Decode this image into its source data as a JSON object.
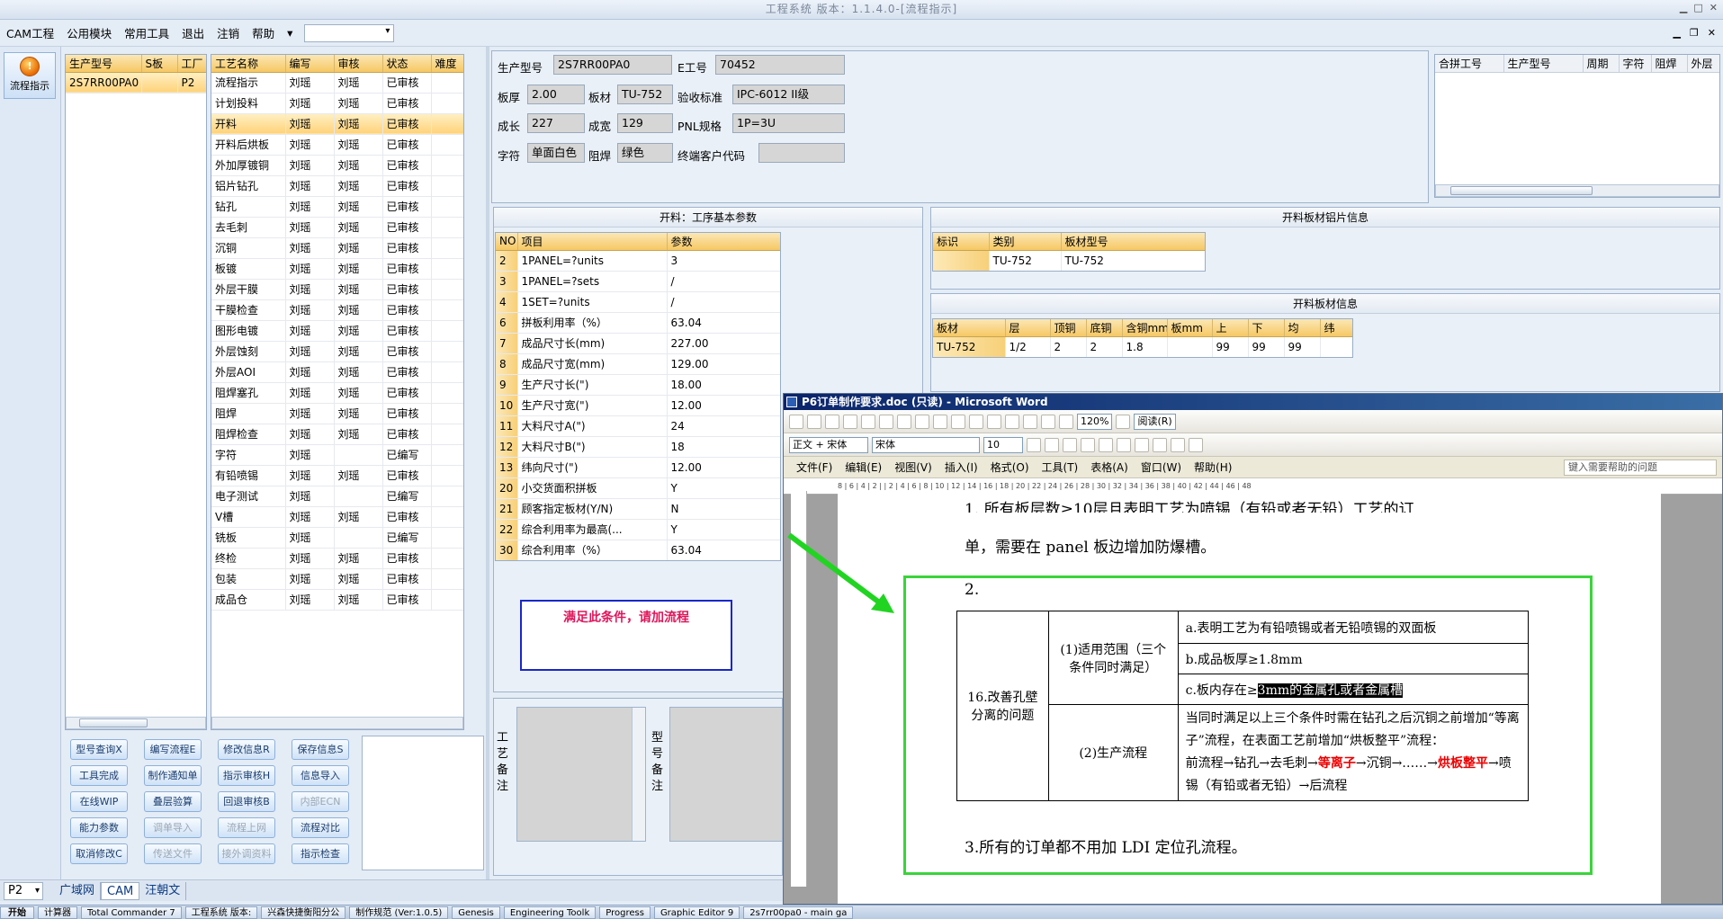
{
  "app": {
    "title": "工程系统 版本：1.1.4.0-[流程指示]",
    "menu": [
      "CAM工程",
      "公用模块",
      "常用工具",
      "退出",
      "注销",
      "帮助"
    ],
    "menu_combo_arrow": "▾",
    "flow_button": "流程指示"
  },
  "part_grid": {
    "headers": [
      "生产型号",
      "S板",
      "工厂"
    ],
    "rows": [
      [
        "2S7RR00PA0",
        "",
        "P2"
      ]
    ]
  },
  "process_grid": {
    "headers": [
      "工艺名称",
      "编写",
      "审核",
      "状态",
      "难度"
    ],
    "selected_index": 2,
    "rows": [
      [
        "流程指示",
        "刘瑶",
        "刘瑶",
        "已审核",
        ""
      ],
      [
        "计划投料",
        "刘瑶",
        "刘瑶",
        "已审核",
        ""
      ],
      [
        "开料",
        "刘瑶",
        "刘瑶",
        "已审核",
        ""
      ],
      [
        "开料后烘板",
        "刘瑶",
        "刘瑶",
        "已审核",
        ""
      ],
      [
        "外加厚镀铜",
        "刘瑶",
        "刘瑶",
        "已审核",
        ""
      ],
      [
        "铝片钻孔",
        "刘瑶",
        "刘瑶",
        "已审核",
        ""
      ],
      [
        "钻孔",
        "刘瑶",
        "刘瑶",
        "已审核",
        ""
      ],
      [
        "去毛刺",
        "刘瑶",
        "刘瑶",
        "已审核",
        ""
      ],
      [
        "沉铜",
        "刘瑶",
        "刘瑶",
        "已审核",
        ""
      ],
      [
        "板镀",
        "刘瑶",
        "刘瑶",
        "已审核",
        ""
      ],
      [
        "外层干膜",
        "刘瑶",
        "刘瑶",
        "已审核",
        ""
      ],
      [
        "干膜检查",
        "刘瑶",
        "刘瑶",
        "已审核",
        ""
      ],
      [
        "图形电镀",
        "刘瑶",
        "刘瑶",
        "已审核",
        ""
      ],
      [
        "外层蚀刻",
        "刘瑶",
        "刘瑶",
        "已审核",
        ""
      ],
      [
        "外层AOI",
        "刘瑶",
        "刘瑶",
        "已审核",
        ""
      ],
      [
        "阻焊塞孔",
        "刘瑶",
        "刘瑶",
        "已审核",
        ""
      ],
      [
        "阻焊",
        "刘瑶",
        "刘瑶",
        "已审核",
        ""
      ],
      [
        "阻焊检查",
        "刘瑶",
        "刘瑶",
        "已审核",
        ""
      ],
      [
        "字符",
        "刘瑶",
        "",
        "已编写",
        ""
      ],
      [
        "有铅喷锡",
        "刘瑶",
        "刘瑶",
        "已审核",
        ""
      ],
      [
        "电子测试",
        "刘瑶",
        "",
        "已编写",
        ""
      ],
      [
        "V槽",
        "刘瑶",
        "刘瑶",
        "已审核",
        ""
      ],
      [
        "铣板",
        "刘瑶",
        "",
        "已编写",
        ""
      ],
      [
        "终检",
        "刘瑶",
        "刘瑶",
        "已审核",
        ""
      ],
      [
        "包装",
        "刘瑶",
        "刘瑶",
        "已审核",
        ""
      ],
      [
        "成品仓",
        "刘瑶",
        "刘瑶",
        "已审核",
        ""
      ]
    ]
  },
  "buttons": [
    {
      "label": "型号查询X",
      "enabled": true
    },
    {
      "label": "编写流程E",
      "enabled": true
    },
    {
      "label": "修改信息R",
      "enabled": true
    },
    {
      "label": "保存信息S",
      "enabled": true
    },
    {
      "label": "工具完成",
      "enabled": true
    },
    {
      "label": "制作通知单",
      "enabled": true
    },
    {
      "label": "指示审核H",
      "enabled": true
    },
    {
      "label": "信息导入",
      "enabled": true
    },
    {
      "label": "在线WIP",
      "enabled": true
    },
    {
      "label": "叠层验算",
      "enabled": true
    },
    {
      "label": "回退审核B",
      "enabled": true
    },
    {
      "label": "内部ECN",
      "enabled": false
    },
    {
      "label": "能力参数",
      "enabled": true
    },
    {
      "label": "调单导入",
      "enabled": false
    },
    {
      "label": "流程上网",
      "enabled": false
    },
    {
      "label": "流程对比",
      "enabled": true
    },
    {
      "label": "取消修改C",
      "enabled": true
    },
    {
      "label": "传送文件",
      "enabled": false
    },
    {
      "label": "接外调资料",
      "enabled": false
    },
    {
      "label": "指示检查",
      "enabled": true
    }
  ],
  "info": {
    "part_no_label": "生产型号",
    "part_no": "2S7RR00PA0",
    "e_no_label": "E工号",
    "e_no": "70452",
    "thickness_label": "板厚",
    "thickness": "2.00",
    "material_label": "板材",
    "material": "TU-752",
    "standard_label": "验收标准",
    "standard": "IPC-6012 II级",
    "len_label": "成长",
    "len": "227",
    "width_label": "成宽",
    "width": "129",
    "pnl_label": "PNL规格",
    "pnl": "1P=3U",
    "char_label": "字符",
    "char": "单面白色",
    "mask_label": "阻焊",
    "mask": "绿色",
    "cust_label": "终端客户代码",
    "cust": ""
  },
  "merge_grid": {
    "headers": [
      "合拼工号",
      "生产型号",
      "周期",
      "字符",
      "阻焊",
      "外层"
    ]
  },
  "params": {
    "title": "开料：工序基本参数",
    "headers": [
      "NO",
      "项目",
      "参数"
    ],
    "rows": [
      [
        "2",
        "1PANEL=?units",
        "3"
      ],
      [
        "3",
        "1PANEL=?sets",
        "/"
      ],
      [
        "4",
        "1SET=?units",
        "/"
      ],
      [
        "6",
        "拼板利用率（%）",
        "63.04"
      ],
      [
        "7",
        "成品尺寸长(mm)",
        "227.00"
      ],
      [
        "8",
        "成品尺寸宽(mm)",
        "129.00"
      ],
      [
        "9",
        "生产尺寸长(\")",
        "18.00"
      ],
      [
        "10",
        "生产尺寸宽(\")",
        "12.00"
      ],
      [
        "11",
        "大料尺寸A(\")",
        "24"
      ],
      [
        "12",
        "大料尺寸B(\")",
        "18"
      ],
      [
        "13",
        "纬向尺寸(\")",
        "12.00"
      ],
      [
        "20",
        "小交货面积拼板",
        "Y"
      ],
      [
        "21",
        "顾客指定板材(Y/N)",
        "N"
      ],
      [
        "22",
        "综合利用率为最高(...",
        "Y"
      ],
      [
        "30",
        "综合利用率（%）",
        "63.04"
      ]
    ]
  },
  "sheet_info": {
    "title": "开料板材铝片信息",
    "headers": [
      "标识",
      "类别",
      "板材型号"
    ],
    "rows": [
      [
        "",
        "TU-752",
        "TU-752"
      ]
    ]
  },
  "board_info": {
    "title": "开料板材信息",
    "headers": [
      "板材",
      "层",
      "顶铜",
      "底铜",
      "含铜mm",
      "板mm",
      "上",
      "下",
      "均",
      "纬"
    ],
    "rows": [
      [
        "TU-752",
        "1/2",
        "2",
        "2",
        "1.8",
        "",
        "99",
        "99",
        "99",
        ""
      ]
    ]
  },
  "note_box": "满足此条件，请加流程",
  "remark_labels": {
    "process": "工艺备注",
    "model": "型号备注"
  },
  "status": {
    "combo": "P2",
    "tabs": [
      "广域网",
      "CAM",
      "汪朝文"
    ],
    "active_tab": 1
  },
  "word": {
    "title": "P6订单制作要求.doc (只读) - Microsoft Word",
    "style": "正文 + 宋体",
    "font": "宋体",
    "size": "10",
    "zoom": "120%",
    "read_btn": "阅读(R)",
    "menu": [
      "文件(F)",
      "编辑(E)",
      "视图(V)",
      "插入(I)",
      "格式(O)",
      "工具(T)",
      "表格(A)",
      "窗口(W)",
      "帮助(H)"
    ],
    "help_placeholder": "键入需要帮助的问题",
    "ruler": "8  |  6  |  4  |  2  |  |  2  |  4  |  6  |  8  | 10 | 12 | 14 | 16 | 18 | 20 | 22 | 24 | 26 | 28 | 30 | 32 | 34 | 36 | 38 | 40 | 42 | 44 | 46 | 48",
    "line1a": "1. 所有板层数≥10层且表明工艺为喷锡（有铅或者无铅）工艺的订",
    "line1b": "单，需要在 panel 板边增加防爆槽。",
    "line2": "2.",
    "line3": "3.所有的订单都不用加 LDI 定位孔流程。",
    "table": {
      "item": "16.改善孔壁分离的问题",
      "scope_label": "(1)适用范围（三个条件同时满足）",
      "cond_a": "a.表明工艺为有铅喷锡或者无铅喷锡的双面板",
      "cond_b": "b.成品板厚≥1.8mm",
      "cond_c_pre": "c.板内存在≥",
      "cond_c_hl": "3mm的金属孔或者金属槽",
      "flow_label": "(2)生产流程",
      "flow_desc": "当同时满足以上三个条件时需在钻孔之后沉铜之前增加“等离子”流程，在表面工艺前增加“烘板整平”流程：",
      "flow_pre": "前流程→钻孔→去毛刺→",
      "flow_red1": "等离子",
      "flow_mid": "→沉铜→……→",
      "flow_red2": "烘板整平",
      "flow_post": "→喷锡（有铅或者无铅）→后流程"
    }
  },
  "taskbar": {
    "start": "开始",
    "items": [
      "计算器",
      "Total Commander 7",
      "工程系统 版本:",
      "兴森快捷衡阳分公",
      "制作规范 (Ver:1.0.5)",
      "Genesis",
      "Engineering Toolk",
      "Progress",
      "Graphic Editor 9",
      "2s7rr00pa0 - main ga"
    ]
  }
}
